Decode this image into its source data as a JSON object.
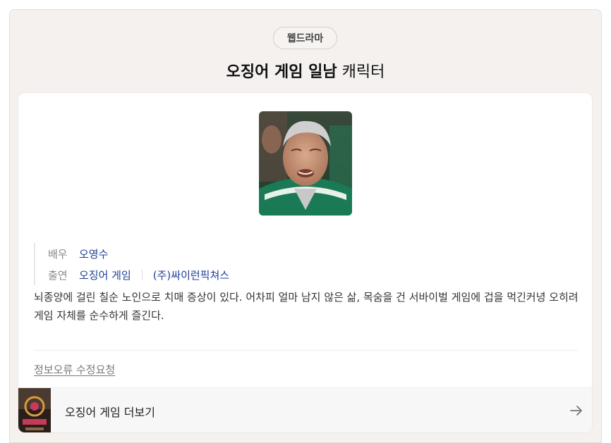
{
  "category_pill": "웹드라마",
  "title": {
    "name": "오징어 게임 일남",
    "suffix": "캐릭터"
  },
  "info": {
    "actor_label": "배우",
    "actor_value": "오영수",
    "appear_label": "출연",
    "appear_value_1": "오징어 게임",
    "appear_value_2": "(주)싸이런픽쳐스"
  },
  "description": "뇌종양에 걸린 칠순 노인으로 치매 증상이 있다. 어차피 얼마 남지 않은 삶, 목숨을 건 서바이벌 게임에 겁을 먹긴커녕 오히려 게임 자체를 순수하게 즐긴다.",
  "report_link": "정보오류 수정요청",
  "more_link": "오징어 게임 더보기"
}
